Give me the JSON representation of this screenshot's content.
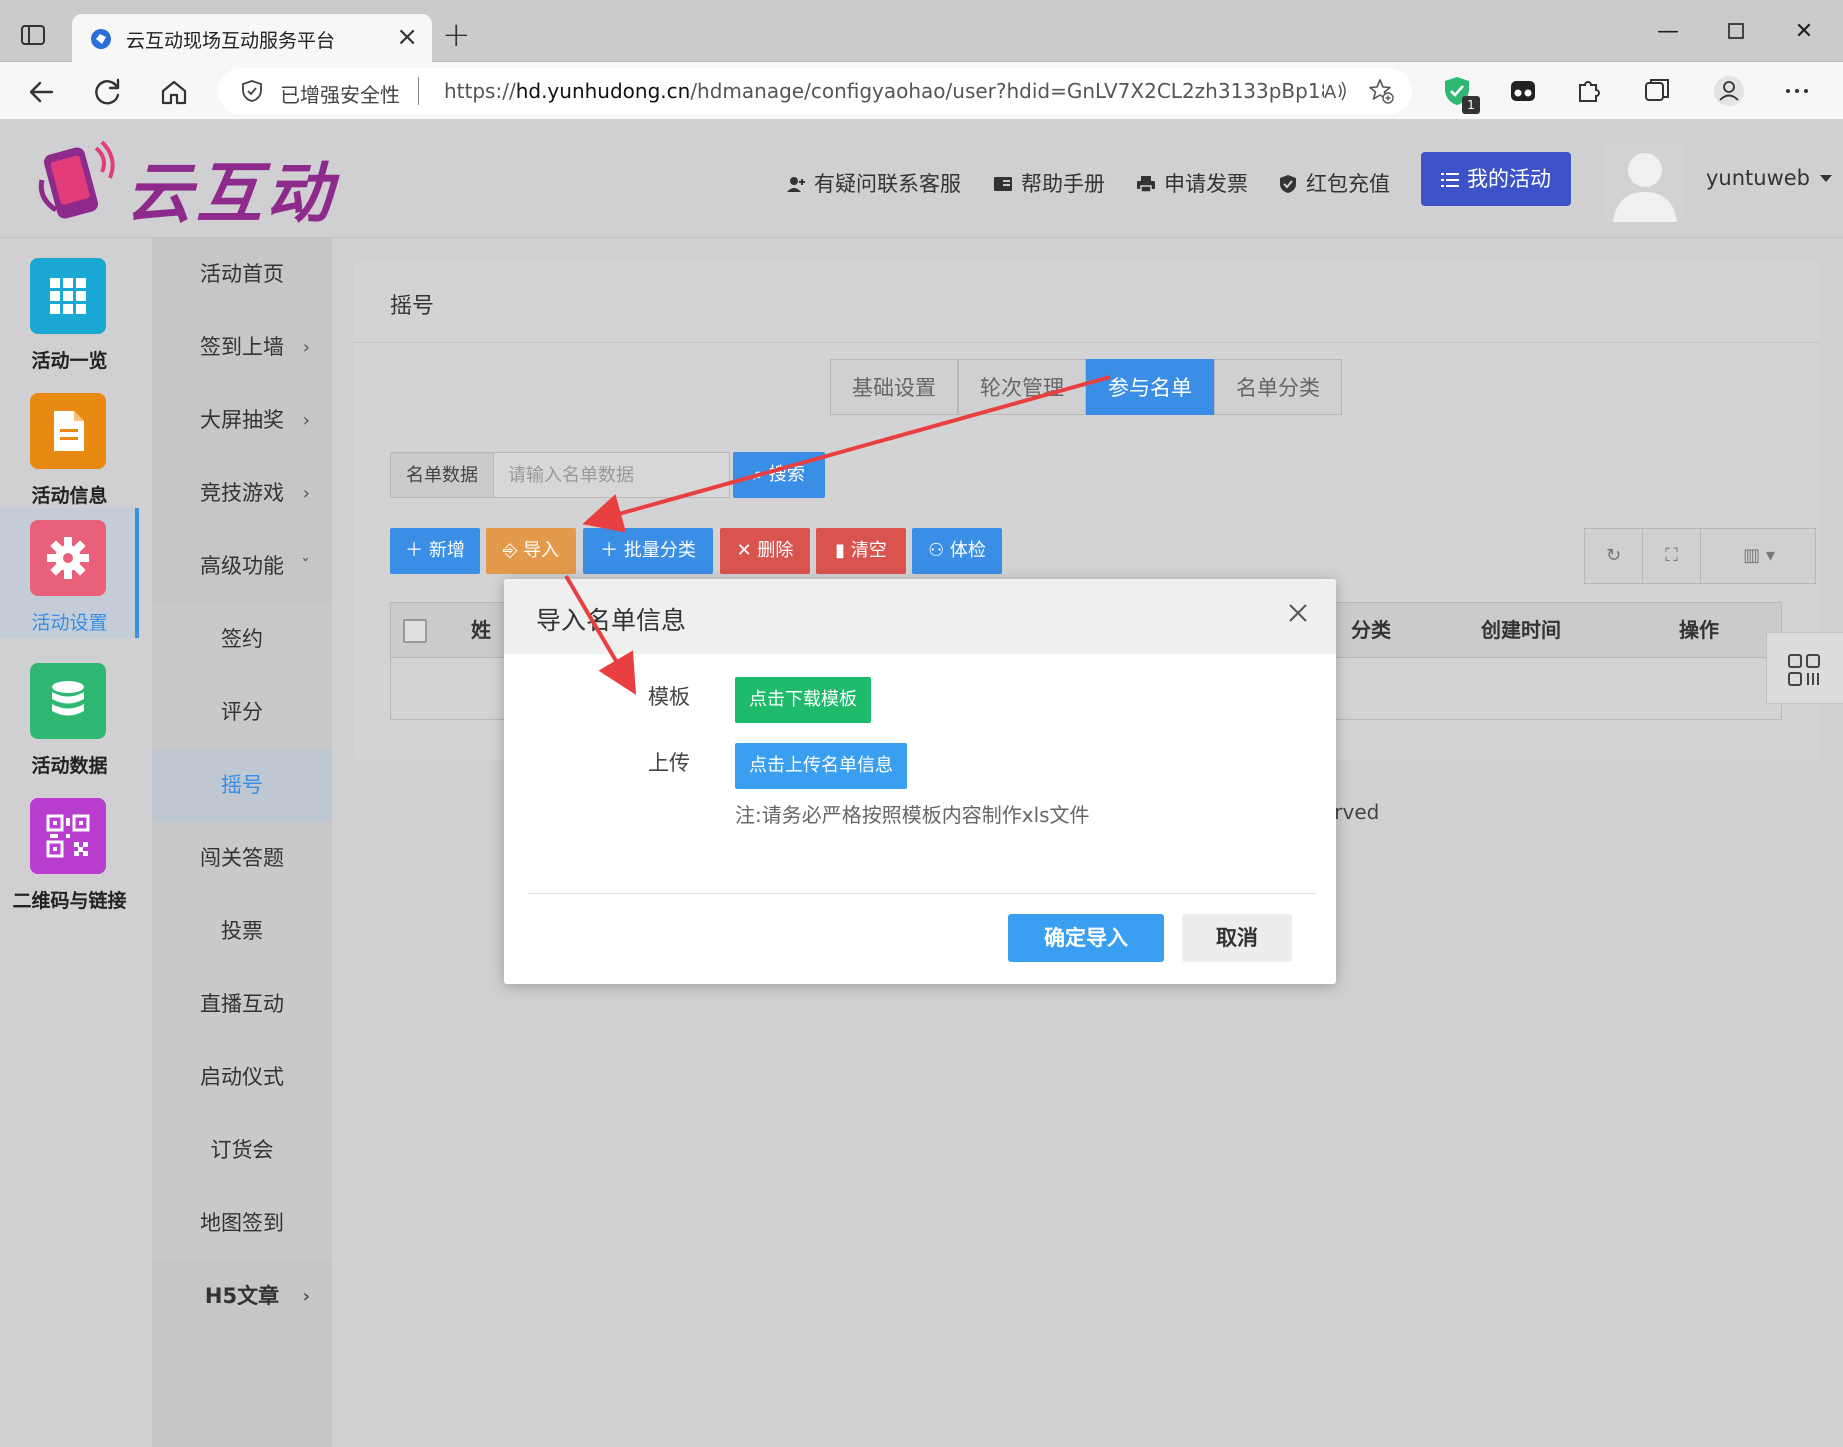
{
  "browser": {
    "tab_title": "云互动现场互动服务平台",
    "security_label": "已增强安全性",
    "url_prefix": "https://",
    "url_host": "hd.yunhudong.cn",
    "url_path": "/hdmanage/configyaohao/user?hdid=GnLV7X2CL2zh3133pBp18...",
    "extension_badge": "1"
  },
  "header": {
    "logo_text": "云互动",
    "links": {
      "support": "有疑问联系客服",
      "manual": "帮助手册",
      "invoice": "申请发票",
      "recharge": "红包充值"
    },
    "my_activity": "我的活动",
    "username": "yuntuweb"
  },
  "icon_sidebar": [
    {
      "label": "活动一览",
      "color": "#1aa9d4",
      "icon": "grid-icon"
    },
    {
      "label": "活动信息",
      "color": "#e88a12",
      "icon": "document-icon"
    },
    {
      "label": "活动设置",
      "color": "#e8607a",
      "icon": "gear-icon"
    },
    {
      "label": "活动数据",
      "color": "#2eb872",
      "icon": "database-icon"
    },
    {
      "label": "二维码与链接",
      "color": "#b93ed0",
      "icon": "qrcode-icon"
    }
  ],
  "sub_sidebar": {
    "home": "活动首页",
    "signin": "签到上墙",
    "lottery": "大屏抽奖",
    "games": "竞技游戏",
    "advanced": "高级功能",
    "children": [
      "签约",
      "评分",
      "摇号",
      "闯关答题",
      "投票",
      "直播互动",
      "启动仪式",
      "订货会",
      "地图签到"
    ],
    "h5": "H5文章"
  },
  "content": {
    "title": "摇号",
    "tabs": [
      "基础设置",
      "轮次管理",
      "参与名单",
      "名单分类"
    ],
    "search": {
      "label": "名单数据",
      "placeholder": "请输入名单数据",
      "button": "搜索"
    },
    "toolbar": {
      "add": "新增",
      "import": "导入",
      "batch_category": "批量分类",
      "delete": "删除",
      "clear": "清空",
      "check": "体检"
    },
    "table_headers": {
      "name_fragment": "姓",
      "category": "分类",
      "created": "创建时间",
      "actions": "操作"
    },
    "footer_fragment": "erved"
  },
  "modal": {
    "title": "导入名单信息",
    "template_label": "模板",
    "download_button": "点击下载模板",
    "upload_label": "上传",
    "upload_button": "点击上传名单信息",
    "note": "注:请务必严格按照模板内容制作xls文件",
    "confirm": "确定导入",
    "cancel": "取消"
  },
  "colors": {
    "primary": "#3a8ee6",
    "warning": "#e39a4a",
    "danger": "#d9534f",
    "success": "#1fbb6b",
    "brand": "#8d2a8c",
    "annotation": "#e84040"
  }
}
